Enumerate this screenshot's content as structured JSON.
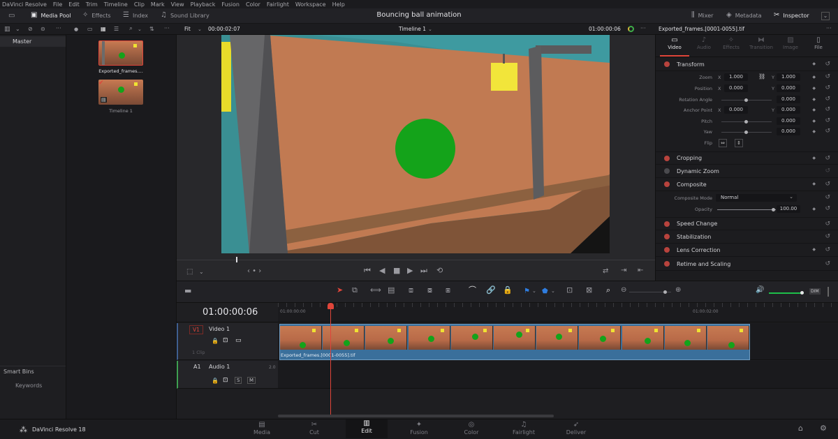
{
  "menu": [
    "DaVinci Resolve",
    "File",
    "Edit",
    "Trim",
    "Timeline",
    "Clip",
    "Mark",
    "View",
    "Playback",
    "Fusion",
    "Color",
    "Fairlight",
    "Workspace",
    "Help"
  ],
  "toolbar": {
    "media_pool": "Media Pool",
    "effects": "Effects",
    "index": "Index",
    "sound_library": "Sound Library",
    "project_title": "Bouncing ball animation",
    "mixer": "Mixer",
    "metadata": "Metadata",
    "inspector": "Inspector"
  },
  "subbar": {
    "fit": "Fit",
    "source_tc": "00:00:02:07",
    "timeline_name": "Timeline 1",
    "record_tc": "01:00:00:06",
    "clip_name": "Exported_frames.[0001-0055].tif"
  },
  "bins": {
    "master": "Master",
    "smart_bins": "Smart Bins",
    "keywords": "Keywords"
  },
  "pool": [
    {
      "label": "Exported_frames...."
    },
    {
      "label": "Timeline 1"
    }
  ],
  "inspector": {
    "tabs": [
      "Video",
      "Audio",
      "Effects",
      "Transition",
      "Image",
      "File"
    ],
    "transform": {
      "title": "Transform",
      "zoom_label": "Zoom",
      "zoom_x": "1.000",
      "zoom_y": "1.000",
      "position_label": "Position",
      "position_x": "0.000",
      "position_y": "0.000",
      "rotation_label": "Rotation Angle",
      "rotation": "0.000",
      "anchor_label": "Anchor Point",
      "anchor_x": "0.000",
      "anchor_y": "0.000",
      "pitch_label": "Pitch",
      "pitch": "0.000",
      "yaw_label": "Yaw",
      "yaw": "0.000",
      "flip_label": "Flip",
      "x": "X",
      "y": "Y"
    },
    "cropping": "Cropping",
    "dynamic_zoom": "Dynamic Zoom",
    "composite": {
      "title": "Composite",
      "mode_label": "Composite Mode",
      "mode": "Normal",
      "opacity_label": "Opacity",
      "opacity": "100.00"
    },
    "speed_change": "Speed Change",
    "stabilization": "Stabilization",
    "lens_correction": "Lens Correction",
    "retime": "Retime and Scaling"
  },
  "timeline": {
    "timecode": "01:00:00:06",
    "ruler": [
      "01:00:00:00",
      "01:00:02:00"
    ],
    "video_track": {
      "id": "V1",
      "name": "Video 1",
      "clips": "1 Clip"
    },
    "audio_track": {
      "id": "A1",
      "name": "Audio 1",
      "channels": "2.0"
    },
    "clip_label": "Exported_frames.[0001-0055].tif",
    "dim": "DIM",
    "playhead_fraction": 0.15
  },
  "pages": [
    "Media",
    "Cut",
    "Edit",
    "Fusion",
    "Color",
    "Fairlight",
    "Deliver"
  ],
  "active_page": "Edit",
  "app_name": "DaVinci Resolve 18",
  "colors": {
    "accent": "#e0453a",
    "clip_blue": "#3a6f9b",
    "ball": "#13a31a"
  }
}
